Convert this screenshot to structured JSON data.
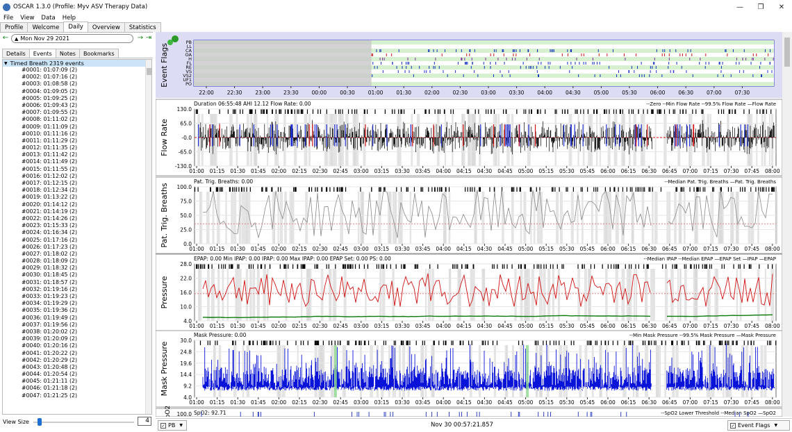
{
  "window": {
    "title": "OSCAR 1.3.0 (Profile: Myv ASV Therapy Data)",
    "minimize": "—",
    "restore": "❐",
    "close": "✕"
  },
  "menu": [
    "File",
    "View",
    "Data",
    "Help"
  ],
  "tabs": [
    "Profile",
    "Welcome",
    "Daily",
    "Overview",
    "Statistics"
  ],
  "date": {
    "value": "Mon Nov 29 2021",
    "prev": "←",
    "next": "→",
    "last": "⇥"
  },
  "subtabs": [
    "Details",
    "Events",
    "Notes",
    "Bookmarks"
  ],
  "event_header": "Timed Breath 2319 events",
  "events": [
    "#0001: 01:07:09 (2)",
    "#0002: 01:07:16 (2)",
    "#0003: 01:08:58 (2)",
    "#0004: 01:09:05 (2)",
    "#0005: 01:09:25 (2)",
    "#0006: 01:09:43 (2)",
    "#0007: 01:09:55 (2)",
    "#0008: 01:11:02 (2)",
    "#0009: 01:11:09 (2)",
    "#0010: 01:11:16 (2)",
    "#0011: 01:11:29 (2)",
    "#0012: 01:11:35 (2)",
    "#0013: 01:11:42 (2)",
    "#0014: 01:11:49 (2)",
    "#0015: 01:11:55 (2)",
    "#0016: 01:12:02 (2)",
    "#0017: 01:12:15 (2)",
    "#0018: 01:12:34 (2)",
    "#0019: 01:13:22 (2)",
    "#0020: 01:14:12 (2)",
    "#0021: 01:14:19 (2)",
    "#0022: 01:14:26 (2)",
    "#0023: 01:15:33 (2)",
    "#0024: 01:16:34 (2)",
    "#0025: 01:17:16 (2)",
    "#0026: 01:17:23 (2)",
    "#0027: 01:18:02 (2)",
    "#0028: 01:18:09 (2)",
    "#0029: 01:18:32 (2)",
    "#0030: 01:18:45 (2)",
    "#0031: 01:18:57 (2)",
    "#0032: 01:19:16 (2)",
    "#0033: 01:19:23 (2)",
    "#0034: 01:19:29 (2)",
    "#0035: 01:19:36 (2)",
    "#0036: 01:19:49 (2)",
    "#0037: 01:19:56 (2)",
    "#0038: 01:20:02 (2)",
    "#0039: 01:20:09 (2)",
    "#0040: 01:20:16 (2)",
    "#0041: 01:20:22 (2)",
    "#0042: 01:20:29 (2)",
    "#0043: 01:20:48 (2)",
    "#0044: 01:20:54 (2)",
    "#0045: 01:21:11 (2)",
    "#0046: 01:21:18 (2)",
    "#0047: 01:21:25 (2)"
  ],
  "view_size": {
    "label": "View Size",
    "value": "4"
  },
  "event_flags": {
    "title": "Event Flags",
    "rows": [
      "PB",
      "LL",
      "CA",
      "OA",
      "H",
      "FL",
      "RE",
      "VS",
      "VS2",
      "UF1",
      "PO"
    ],
    "ticks": [
      "22:00",
      "22:30",
      "23:00",
      "23:30",
      "00:00",
      "00:30",
      "01:00",
      "01:30",
      "02:00",
      "02:30",
      "03:00",
      "03:30",
      "04:00",
      "04:30",
      "05:00",
      "05:30",
      "06:00",
      "06:30",
      "07:00",
      "07:30"
    ]
  },
  "time_ticks": [
    "01:00",
    "01:15",
    "01:30",
    "01:45",
    "02:00",
    "02:15",
    "02:30",
    "02:45",
    "03:00",
    "03:15",
    "03:30",
    "03:45",
    "04:00",
    "04:15",
    "04:30",
    "04:45",
    "05:00",
    "05:15",
    "05:30",
    "05:45",
    "06:00",
    "06:15",
    "06:30",
    "06:45",
    "07:00",
    "07:15",
    "07:30",
    "07:45",
    "08:00"
  ],
  "charts": [
    {
      "key": "flow",
      "title": "Flow Rate",
      "info": "Duration 06:55:48 AHI 12.12 Flow Rate: 0.00",
      "legend": [
        "--Zero",
        "--Min Flow Rate",
        "--99.5% Flow Rate",
        "—Flow Rate"
      ],
      "yticks": [
        "130.0",
        "65.0",
        "-0.0",
        "-65.0",
        "-130.0"
      ],
      "ylim": [
        -130,
        130
      ]
    },
    {
      "key": "ptb",
      "title": "Pat. Trig. Breaths",
      "info": "Pat. Trig. Breaths: 0.00",
      "legend": [
        "--Median Pat. Trig. Breaths",
        "—Pat. Trig. Breaths"
      ],
      "yticks": [
        "100.0",
        "75.0",
        "50.0",
        "25.0",
        "0.0"
      ],
      "ylim": [
        0,
        100
      ]
    },
    {
      "key": "pressure",
      "title": "Pressure",
      "info": "EPAP: 0.00 Min IPAP: 0.00 IPAP: 0.00 Max IPAP: 0.00 EPAP Set: 0.00 PS: 0.00",
      "legend": [
        "--Median IPAP",
        "--Median EPAP",
        "—EPAP Set",
        "—IPAP",
        "—EPAP"
      ],
      "yticks": [
        "28.0",
        "22.0",
        "16.0",
        "10.0",
        "4.0"
      ],
      "ylim": [
        4,
        28
      ]
    },
    {
      "key": "mask",
      "title": "Mask Pressure",
      "info": "Mask Pressure: 0.00",
      "legend": [
        "--Min Mask Pressure",
        "--99.5% Mask Pressure",
        "—Mask Pressure"
      ],
      "yticks": [
        "30.0",
        "24.8",
        "19.6",
        "14.4",
        "9.2",
        "4.0"
      ],
      "ylim": [
        4,
        30
      ]
    },
    {
      "key": "spo2",
      "title": "SpO2",
      "info": "SpO2: 92.71",
      "legend": [
        "--SpO2 Lower Threshold",
        "--Median SpO2",
        "—SpO2"
      ],
      "yticks": [
        "100.0"
      ],
      "ylim": [
        80,
        100
      ]
    }
  ],
  "bottom": {
    "left": "PB",
    "middle": "Nov 30 00:57:21.857",
    "right": "Event Flags"
  },
  "colors": {
    "flow": "#000000",
    "ipap": "#d01010",
    "epap": "#0a7a0a",
    "mask": "#0a14d8",
    "ptb": "#888888",
    "flag_bg": "#d6f0d0",
    "flag_gray": "#c8c8c8",
    "sel": "#cce4f7"
  }
}
